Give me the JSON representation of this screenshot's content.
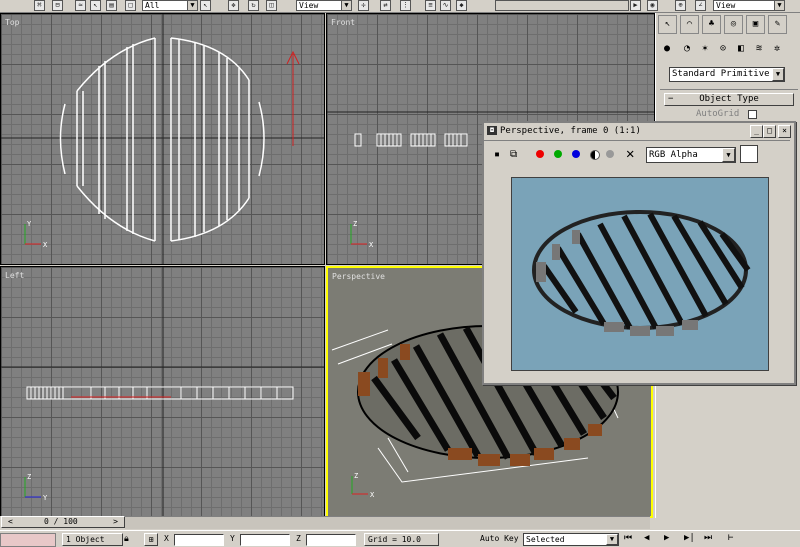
{
  "toolbar": {
    "selection_filter": "All",
    "ref_coord_1": "View",
    "ref_coord_2": "View"
  },
  "viewports": {
    "top": "Top",
    "front": "Front",
    "left": "Left",
    "perspective": "Perspective"
  },
  "command_panel": {
    "category_dropdown": "Standard Primitive",
    "rollout_title": "Object Type",
    "autogrid_label": "AutoGrid"
  },
  "frame_window": {
    "title": "Perspective, frame 0 (1:1)",
    "channel_dropdown": "RGB Alpha"
  },
  "timeline": {
    "frame_counter": "0 / 100"
  },
  "status": {
    "selection_count": "1 Object",
    "x_label": "X",
    "y_label": "Y",
    "z_label": "Z",
    "grid_readout": "Grid = 10.0",
    "auto_key_label": "Auto Key",
    "key_filter": "Selected"
  },
  "colors": {
    "viewport_bg": "#808080",
    "render_bg": "#7aa3b8",
    "active_border": "#ffff00",
    "slat_color": "#8a4a20"
  }
}
